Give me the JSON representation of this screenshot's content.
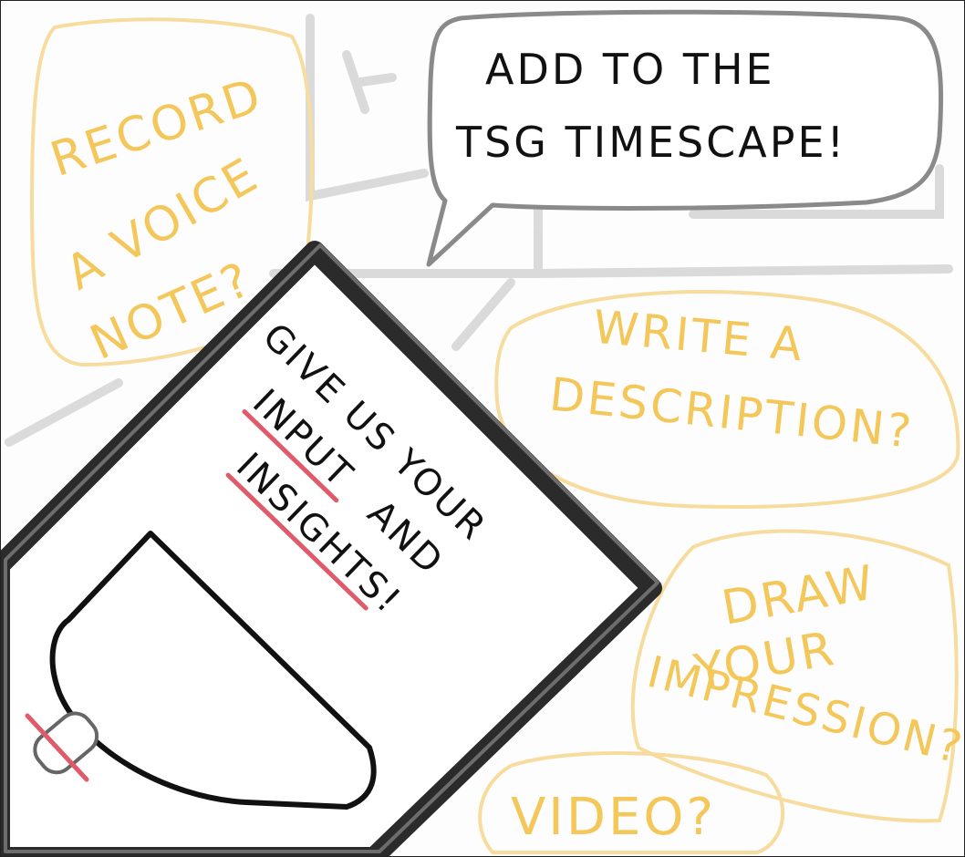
{
  "speech_bubble": {
    "line1": "ADD TO THE",
    "line2": "TSG TIMESCAPE!"
  },
  "voice_note": {
    "line1": "RECORD",
    "line2": "A VOICE",
    "line3": "NOTE?"
  },
  "description": {
    "line1": "WRITE A",
    "line2": "DESCRIPTION?"
  },
  "drawing": {
    "line1": "DRAW",
    "line2": "YOUR",
    "line3": "IMPRESSION?"
  },
  "video": {
    "label": "VIDEO?"
  },
  "tablet": {
    "line1": "GIVE US YOUR",
    "line2_word1": "INPUT",
    "line2_word2": "AND",
    "line3": "INSIGHTS!"
  },
  "colors": {
    "ink": "#111111",
    "highlight_yellow": "#f4c75a",
    "underline_red": "#e05a6a",
    "sketch_grey": "#c9c9c9"
  }
}
